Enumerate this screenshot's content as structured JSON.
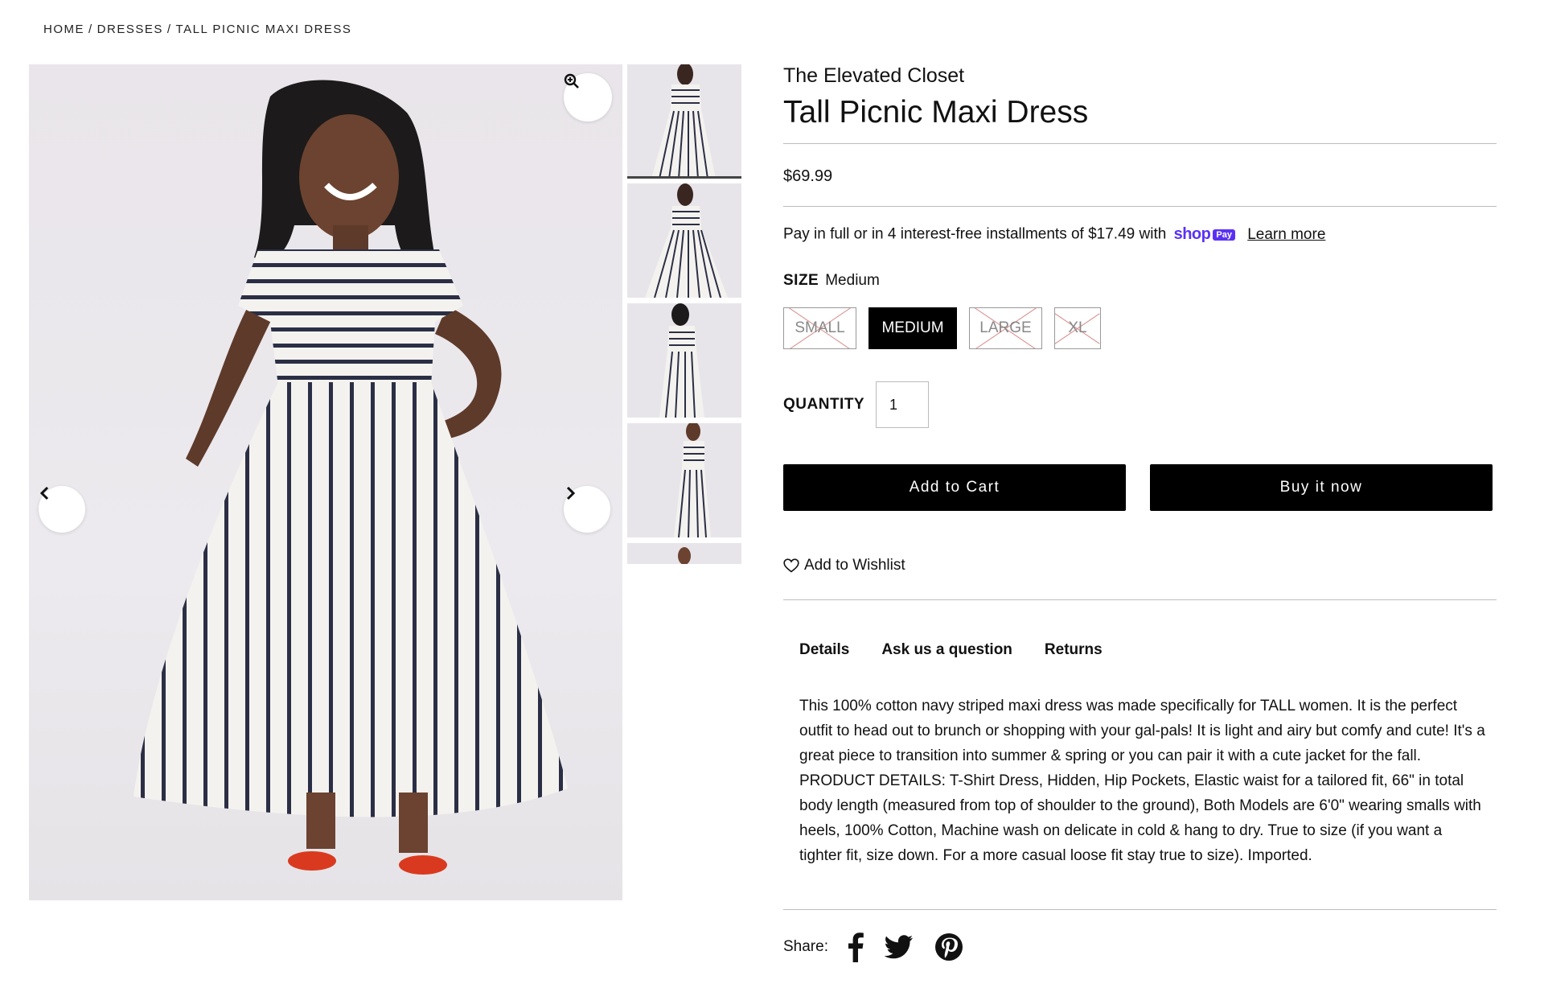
{
  "breadcrumb": {
    "home": "HOME",
    "dresses": "DRESSES",
    "current": "TALL PICNIC MAXI DRESS",
    "separator": "/"
  },
  "product": {
    "brand": "The Elevated Closet",
    "title": "Tall Picnic Maxi Dress",
    "price": "$69.99",
    "installments_text": "Pay in full or in 4 interest-free installments of $17.49 with",
    "shoppay_shop": "shop",
    "shoppay_pay": "Pay",
    "learn_more": "Learn more",
    "size_heading": "SIZE",
    "size_selected": "Medium",
    "sizes": [
      {
        "label": "SMALL",
        "available": false,
        "selected": false
      },
      {
        "label": "MEDIUM",
        "available": true,
        "selected": true
      },
      {
        "label": "LARGE",
        "available": false,
        "selected": false
      },
      {
        "label": "XL",
        "available": false,
        "selected": false
      }
    ],
    "quantity_label": "QUANTITY",
    "quantity_value": "1",
    "add_to_cart": "Add to Cart",
    "buy_now": "Buy it now",
    "wishlist": "Add to Wishlist",
    "tabs": [
      "Details",
      "Ask us a question",
      "Returns"
    ],
    "description": "This 100% cotton navy striped maxi dress was made specifically for TALL women. It is the perfect outfit to head out to brunch or shopping with your gal-pals! It is light and airy but comfy and cute! It's a great piece to transition into summer & spring or you can pair it with a cute jacket for the fall. PRODUCT DETAILS: T-Shirt Dress, Hidden, Hip Pockets, Elastic waist for a tailored fit, 66\" in total body length (measured from top of shoulder to the ground), Both Models are 6'0\" wearing smalls with heels, 100% Cotton, Machine wash on delicate in cold & hang to dry. True to size (if you want a tighter fit, size down. For a more casual loose fit stay true to size). Imported.",
    "share_label": "Share:"
  },
  "icons": {
    "zoom": "zoom-in-icon",
    "prev": "chevron-left-icon",
    "next": "chevron-right-icon",
    "wishlist": "heart-icon",
    "social": [
      "facebook-icon",
      "twitter-icon",
      "pinterest-icon"
    ]
  },
  "colors": {
    "accent": "#000000",
    "shoppay": "#5a31f4",
    "rule": "#bdbdbd"
  }
}
